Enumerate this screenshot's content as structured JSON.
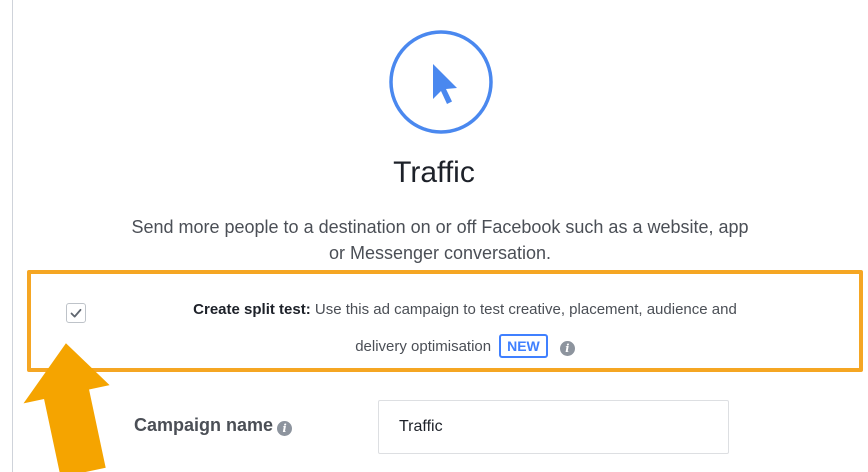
{
  "objective": {
    "icon": "cursor-arrow-icon",
    "title": "Traffic",
    "description_line1": "Send more people to a destination on or off Facebook such as a website, app",
    "description_line2": "or Messenger conversation."
  },
  "split_test": {
    "checked": true,
    "label_bold": "Create split test:",
    "label_text": " Use this ad campaign to test creative, placement, audience and",
    "label_text_line2": "delivery optimisation",
    "badge": "NEW",
    "info_icon": "info-icon"
  },
  "campaign": {
    "label": "Campaign name",
    "info_icon": "info-icon",
    "value": "Traffic"
  },
  "colors": {
    "accent_blue": "#4080ff",
    "highlight_orange": "#f5a623",
    "text_dark": "#1d2129",
    "text_gray": "#4b4f56"
  }
}
